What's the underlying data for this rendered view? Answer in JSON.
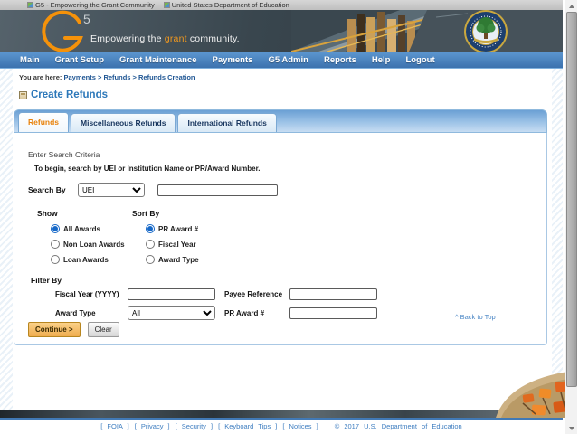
{
  "alt_images": {
    "first": "G5 - Empowering the Grant Community",
    "second": "United States Department of Education"
  },
  "banner": {
    "logo_number": "5",
    "tagline_pre": "Empowering the ",
    "tagline_highlight": "grant",
    "tagline_post": " community."
  },
  "nav": {
    "items": [
      "Main",
      "Grant Setup",
      "Grant Maintenance",
      "Payments",
      "G5 Admin",
      "Reports",
      "Help",
      "Logout"
    ]
  },
  "breadcrumb": {
    "prefix": "You are here:",
    "path": "Payments > Refunds > Refunds Creation"
  },
  "heading": "Create Refunds",
  "tabs": {
    "refunds": "Refunds",
    "miscellaneous": "Miscellaneous Refunds",
    "international": "International Refunds"
  },
  "form": {
    "section_title": "Enter Search Criteria",
    "instructions": "To begin, search by UEI or Institution Name or PR/Award Number.",
    "search_by": {
      "label": "Search By",
      "selected": "UEI",
      "value": ""
    },
    "show": {
      "label": "Show",
      "options": [
        {
          "label": "All Awards",
          "checked": true
        },
        {
          "label": "Non Loan Awards"
        },
        {
          "label": "Loan Awards"
        }
      ]
    },
    "sort_by": {
      "label": "Sort By",
      "options": [
        {
          "label": "PR Award #",
          "checked": true
        },
        {
          "label": "Fiscal Year"
        },
        {
          "label": "Award Type"
        }
      ]
    },
    "filter_by": {
      "label": "Filter By",
      "fiscal_year_label": "Fiscal Year (YYYY)",
      "payee_reference_label": "Payee Reference",
      "award_type_label": "Award Type",
      "award_type_selected": "All",
      "pr_award_label": "PR Award #"
    },
    "buttons": {
      "continue": "Continue >",
      "clear": "Clear"
    }
  },
  "back_to_top": "^ Back to Top",
  "footer": {
    "links": [
      "[ FOIA ]",
      "[ Privacy ]",
      "[ Security ]",
      "[ Keyboard Tips ]",
      "[ Notices ]"
    ],
    "copyright": "© 2017 U.S. Department of Education"
  },
  "colors": {
    "nav_blue": "#4179b5",
    "accent_orange": "#e8820c",
    "link_blue": "#3f7ec0",
    "heading_blue": "#2b77b9",
    "panel_border": "#aac8e4"
  }
}
